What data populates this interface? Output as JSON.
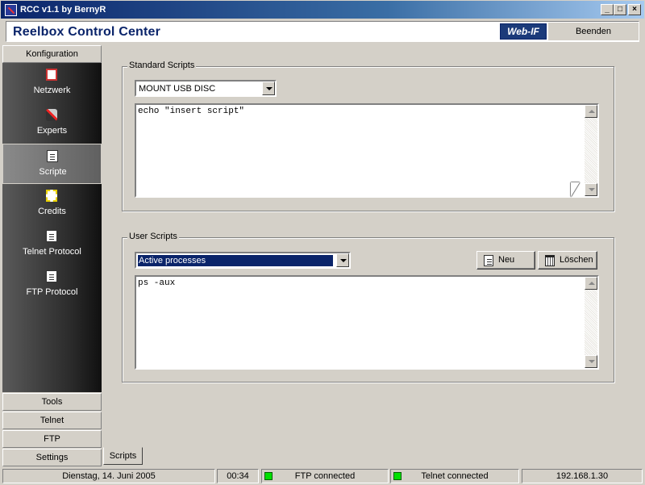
{
  "window": {
    "title": "RCC v1.1 by BernyR"
  },
  "header": {
    "app_title": "Reelbox Control Center",
    "webif_label": "Web-IF",
    "exit_label": "Beenden"
  },
  "sidebar": {
    "top_category": "Konfiguration",
    "items": [
      {
        "label": "Netzwerk",
        "icon": "network-icon"
      },
      {
        "label": "Experts",
        "icon": "tools-icon"
      },
      {
        "label": "Scripte",
        "icon": "document-icon",
        "active": true
      },
      {
        "label": "Credits",
        "icon": "star-icon"
      },
      {
        "label": "Telnet Protocol",
        "icon": "document-icon"
      },
      {
        "label": "FTP Protocol",
        "icon": "document-icon"
      }
    ],
    "bottom_categories": [
      "Tools",
      "Telnet",
      "FTP",
      "Settings"
    ]
  },
  "standard_scripts": {
    "group_title": "Standard Scripts",
    "selected": "MOUNT USB DISC",
    "content": "echo \"insert script\""
  },
  "user_scripts": {
    "group_title": "User Scripts",
    "selected": "Active processes",
    "new_label": "Neu",
    "delete_label": "Löschen",
    "content": "ps -aux"
  },
  "tabs": {
    "active": "Scripts"
  },
  "statusbar": {
    "date": "Dienstag, 14. Juni 2005",
    "time": "00:34",
    "ftp_status": "FTP connected",
    "telnet_status": "Telnet connected",
    "ip": "192.168.1.30"
  },
  "colors": {
    "title_bar": "#0a246a",
    "heading": "#0a246a",
    "status_led": "#00e000",
    "selection": "#0a246a"
  }
}
